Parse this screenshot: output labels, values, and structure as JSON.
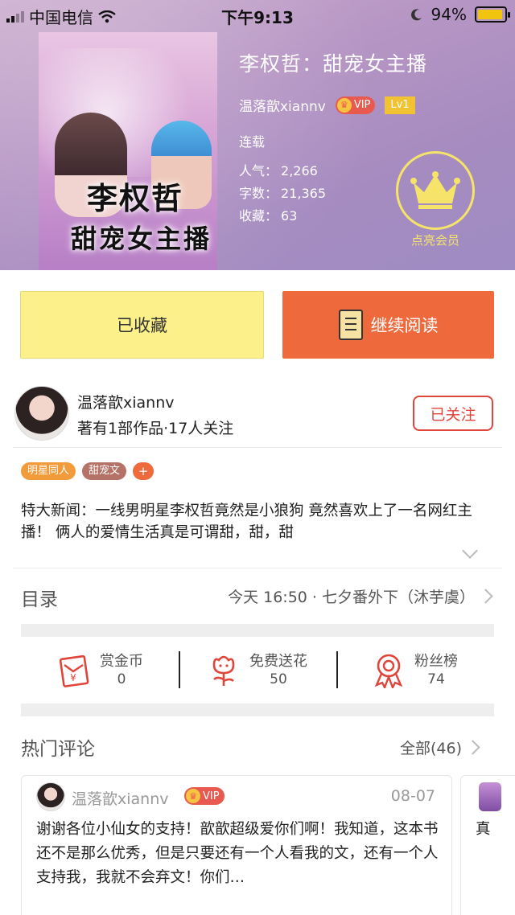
{
  "status_bar": {
    "carrier": "中国电信",
    "time": "下午9:13",
    "battery": "94%",
    "battery_level": 0.94
  },
  "book": {
    "title": "李权哲：甜宠女主播",
    "author": "温落歆xiannv",
    "vip_label": "VIP",
    "level": "Lv1",
    "status": "连载",
    "stats": [
      {
        "label": "人气：",
        "value": "2,266"
      },
      {
        "label": "字数：",
        "value": "21,365"
      },
      {
        "label": "收藏：",
        "value": "63"
      }
    ],
    "cover_text_line1": "李权哲",
    "cover_text_line2": "甜宠女主播"
  },
  "member": {
    "label": "点亮会员"
  },
  "buttons": {
    "collected": "已收藏",
    "continue_reading": "继续阅读"
  },
  "author_section": {
    "name": "温落歆xiannv",
    "subtitle": "著有1部作品·17人关注",
    "follow_label": "已关注"
  },
  "tags": [
    "明星同人",
    "甜宠文",
    "+"
  ],
  "synopsis": "特大新闻：一线男明星李权哲竟然是小狼狗    竟然喜欢上了一名网红主播！ 俩人的爱情生活真是可谓甜，甜，甜",
  "toc": {
    "label": "目录",
    "latest": "今天 16:50 · 七夕番外下（沐芋虞）"
  },
  "actions": [
    {
      "label": "赏金币",
      "count": "0",
      "icon": "coin-envelope-icon"
    },
    {
      "label": "免费送花",
      "count": "50",
      "icon": "flower-icon"
    },
    {
      "label": "粉丝榜",
      "count": "74",
      "icon": "medal-icon"
    }
  ],
  "comments": {
    "title": "热门评论",
    "all_label": "全部(46)",
    "items": [
      {
        "user": "温落歆xiannv",
        "vip_label": "VIP",
        "date": "08-07",
        "text": "谢谢各位小仙女的支持！歆歆超级爱你们啊！我知道，这本书还不是那么优秀，但是只要还有一个人看我的文，还有一个人支持我，我就不会弃文！你们…"
      },
      {
        "text": "真"
      }
    ]
  },
  "colors": {
    "accent_orange": "#ee6a3d",
    "collected_yellow": "#fbf08a",
    "follow_red": "#e0453b",
    "member_gold": "#f6e46a"
  }
}
